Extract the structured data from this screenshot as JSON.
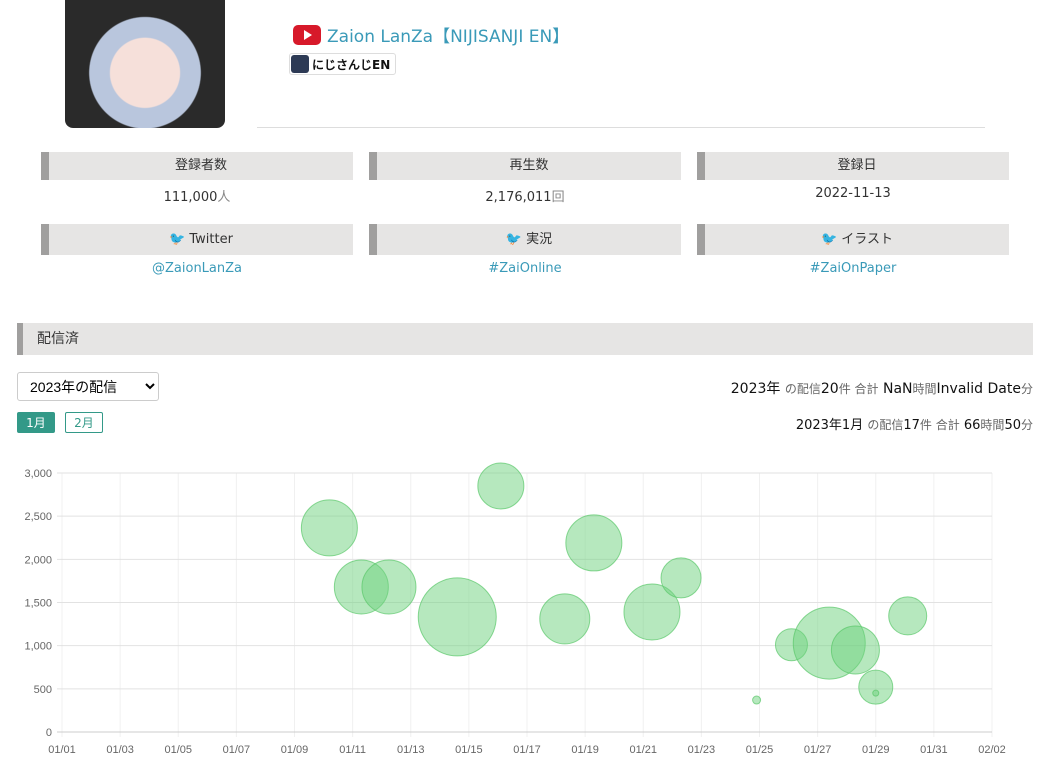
{
  "channel": {
    "name": "Zaion LanZa【NIJISANJI EN】",
    "group": "にじさんじEN"
  },
  "stats": [
    {
      "label": "登録者数",
      "value": "111,000",
      "unit": "人"
    },
    {
      "label": "再生数",
      "value": "2,176,011",
      "unit": "回"
    },
    {
      "label": "登録日",
      "value": "2022-11-13",
      "unit": ""
    }
  ],
  "links": [
    {
      "label": "Twitter",
      "value": "@ZaionLanZa"
    },
    {
      "label": "実況",
      "value": "#ZaiOnline"
    },
    {
      "label": "イラスト",
      "value": "#ZaiOnPaper"
    }
  ],
  "section": {
    "title": "配信済"
  },
  "year_select": {
    "value": "2023年の配信"
  },
  "year_summary": {
    "year": "2023年",
    "t1": "の配信",
    "count": "20",
    "t2": "件 合計",
    "hours": "NaN",
    "t3": "時間",
    "mins": "Invalid Date",
    "t4": "分"
  },
  "months": [
    "1月",
    "2月"
  ],
  "month_summary": {
    "month": "2023年1月",
    "t1": "の配信",
    "count": "17",
    "t2": "件 合計",
    "hours": "66",
    "t3": "時間",
    "mins": "50",
    "t4": "分"
  },
  "colors": {
    "accent": "#339988",
    "bubble": "#8fdc98",
    "link": "#3a9ab8"
  },
  "chart_data": {
    "type": "scatter",
    "subtype": "bubble",
    "x_unit": "days since 01/01",
    "xlim": [
      0,
      32
    ],
    "ylim": [
      0,
      3000
    ],
    "xticks": [
      "01/01",
      "01/03",
      "01/05",
      "01/07",
      "01/09",
      "01/11",
      "01/13",
      "01/15",
      "01/17",
      "01/19",
      "01/21",
      "01/23",
      "01/25",
      "01/27",
      "01/29",
      "01/31",
      "02/02"
    ],
    "yticks": [
      "0",
      "500",
      "1,000",
      "1,500",
      "2,000",
      "2,500",
      "3,000"
    ],
    "points": [
      {
        "x": 9.2,
        "y": 2364,
        "size": 28
      },
      {
        "x": 10.3,
        "y": 1680,
        "size": 27
      },
      {
        "x": 11.25,
        "y": 1680,
        "size": 27
      },
      {
        "x": 13.6,
        "y": 1333,
        "size": 39
      },
      {
        "x": 15.1,
        "y": 2850,
        "size": 23
      },
      {
        "x": 17.3,
        "y": 1310,
        "size": 25
      },
      {
        "x": 18.3,
        "y": 2190,
        "size": 28
      },
      {
        "x": 20.3,
        "y": 1390,
        "size": 28
      },
      {
        "x": 21.3,
        "y": 1785,
        "size": 20
      },
      {
        "x": 23.9,
        "y": 370,
        "size": 4
      },
      {
        "x": 25.1,
        "y": 1010,
        "size": 16
      },
      {
        "x": 26.4,
        "y": 1030,
        "size": 36
      },
      {
        "x": 27.3,
        "y": 950,
        "size": 24
      },
      {
        "x": 28.0,
        "y": 520,
        "size": 17
      },
      {
        "x": 28.0,
        "y": 450,
        "size": 3
      },
      {
        "x": 29.1,
        "y": 1345,
        "size": 19
      }
    ]
  }
}
